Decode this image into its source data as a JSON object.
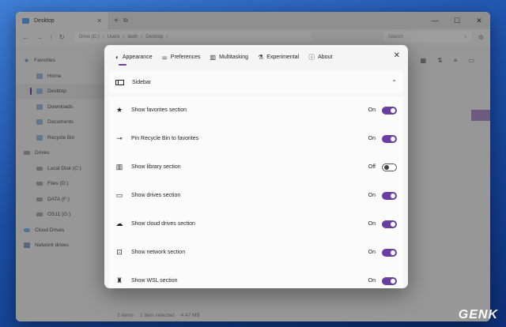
{
  "window": {
    "tab_title": "Desktop",
    "breadcrumb": [
      "Drive (C:)",
      "Users",
      "leeth",
      "Desktop"
    ],
    "search_placeholder": "Search"
  },
  "sidebar": {
    "items": [
      {
        "label": "Favorites",
        "icon": "star-icon",
        "level": 0
      },
      {
        "label": "Home",
        "icon": "home-icon",
        "level": 1
      },
      {
        "label": "Desktop",
        "icon": "desktop-folder-icon",
        "level": 1,
        "selected": true
      },
      {
        "label": "Downloads",
        "icon": "downloads-icon",
        "level": 1
      },
      {
        "label": "Documents",
        "icon": "documents-icon",
        "level": 1
      },
      {
        "label": "Recycle Bin",
        "icon": "recycle-bin-icon",
        "level": 1
      },
      {
        "label": "Drives",
        "icon": "drives-icon",
        "level": 0
      },
      {
        "label": "Local Disk (C:)",
        "icon": "drive-icon",
        "level": 1
      },
      {
        "label": "Files (D:)",
        "icon": "drive-icon",
        "level": 1
      },
      {
        "label": "DATA (F:)",
        "icon": "drive-icon",
        "level": 1
      },
      {
        "label": "OS11 (G:)",
        "icon": "drive-icon",
        "level": 1
      },
      {
        "label": "Cloud Drives",
        "icon": "cloud-icon",
        "level": 0
      },
      {
        "label": "Network drives",
        "icon": "network-icon",
        "level": 0
      }
    ]
  },
  "statusbar": {
    "items": "2 items",
    "selected": "1 item selected",
    "size": "4.47 MB"
  },
  "settings": {
    "tabs": [
      {
        "label": "Appearance",
        "icon": "palette-icon",
        "active": true
      },
      {
        "label": "Preferences",
        "icon": "sliders-icon"
      },
      {
        "label": "Multitasking",
        "icon": "multitasking-icon"
      },
      {
        "label": "Experimental",
        "icon": "flask-icon"
      },
      {
        "label": "About",
        "icon": "info-icon"
      }
    ],
    "section": {
      "label": "Sidebar",
      "icon": "sidebar-icon"
    },
    "options": [
      {
        "label": "Show favorites section",
        "icon": "star-icon",
        "state": "On",
        "on": true
      },
      {
        "label": "Pin Recycle Bin to favorites",
        "icon": "pin-icon",
        "state": "On",
        "on": true
      },
      {
        "label": "Show library section",
        "icon": "library-icon",
        "state": "Off",
        "on": false
      },
      {
        "label": "Show drives section",
        "icon": "drive-icon",
        "state": "On",
        "on": true
      },
      {
        "label": "Show cloud drives section",
        "icon": "cloud-icon",
        "state": "On",
        "on": true
      },
      {
        "label": "Show network section",
        "icon": "network-icon",
        "state": "On",
        "on": true
      },
      {
        "label": "Show WSL section",
        "icon": "linux-icon",
        "state": "On",
        "on": true
      }
    ]
  },
  "watermark": {
    "text_a": "GEN",
    "text_b": "K"
  },
  "colors": {
    "accent": "#6a3fa0",
    "dialog_bg": "#f5f5f5"
  }
}
